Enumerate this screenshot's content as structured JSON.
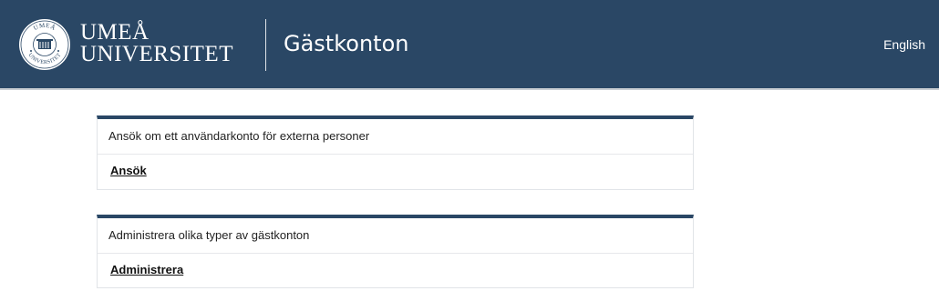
{
  "header": {
    "logo": {
      "seal_text": "UMEÅ UNIVERSITET",
      "wordmark_line1": "UMEÅ",
      "wordmark_line2": "UNIVERSITET"
    },
    "site_title": "Gästkonton",
    "language_link": "English",
    "background_color": "#2a4765"
  },
  "cards": [
    {
      "description": "Ansök om ett användarkonto för externa personer",
      "action_label": "Ansök"
    },
    {
      "description": "Administrera olika typer av gästkonton",
      "action_label": "Administrera"
    }
  ],
  "colors": {
    "accent": "#2a4765",
    "card_border": "#e1e4e8"
  }
}
